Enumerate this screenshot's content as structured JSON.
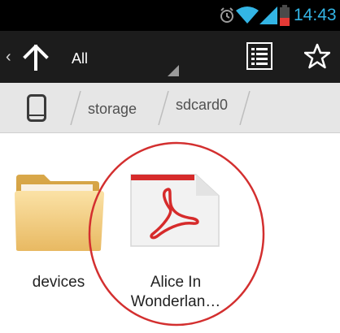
{
  "status_bar": {
    "time": "14:43",
    "icons": [
      "alarm-icon",
      "wifi-icon",
      "signal-icon",
      "battery-icon"
    ],
    "accent_color": "#33b5e5",
    "battery_color": "#e53935"
  },
  "action_bar": {
    "filter_label": "All",
    "icons": [
      "back-chevron-icon",
      "up-arrow-icon",
      "list-view-icon",
      "star-icon"
    ]
  },
  "breadcrumb": {
    "root_icon": "phone-icon",
    "items": [
      {
        "label": "storage"
      },
      {
        "label": "sdcard0"
      }
    ]
  },
  "files": [
    {
      "name": "devices",
      "type": "folder",
      "icon": "folder-icon"
    },
    {
      "name_line1": "Alice In",
      "name_line2": "Wonderlan…",
      "type": "pdf",
      "icon": "pdf-icon",
      "highlighted": true
    }
  ],
  "annotation": {
    "highlight_color": "#d32f2f"
  }
}
